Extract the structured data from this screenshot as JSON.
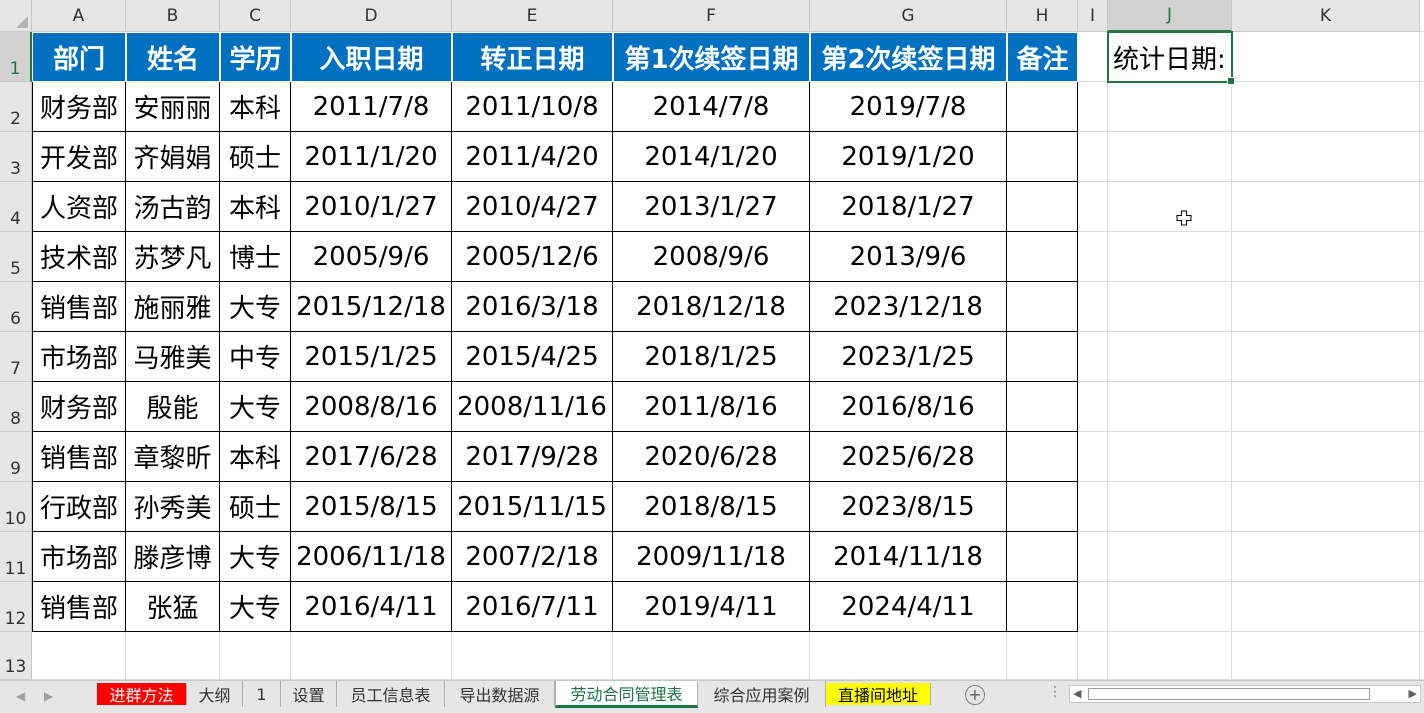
{
  "columns": [
    "A",
    "B",
    "C",
    "D",
    "E",
    "F",
    "G",
    "H",
    "I",
    "J",
    "K"
  ],
  "rows": [
    "1",
    "2",
    "3",
    "4",
    "5",
    "6",
    "7",
    "8",
    "9",
    "10",
    "11",
    "12",
    "13"
  ],
  "selected_column": "J",
  "selected_row": "1",
  "header_row": [
    "部门",
    "姓名",
    "学历",
    "入职日期",
    "转正日期",
    "第1次续签日期",
    "第2次续签日期",
    "备注"
  ],
  "data_rows": [
    [
      "财务部",
      "安丽丽",
      "本科",
      "2011/7/8",
      "2011/10/8",
      "2014/7/8",
      "2019/7/8",
      ""
    ],
    [
      "开发部",
      "齐娟娟",
      "硕士",
      "2011/1/20",
      "2011/4/20",
      "2014/1/20",
      "2019/1/20",
      ""
    ],
    [
      "人资部",
      "汤古韵",
      "本科",
      "2010/1/27",
      "2010/4/27",
      "2013/1/27",
      "2018/1/27",
      ""
    ],
    [
      "技术部",
      "苏梦凡",
      "博士",
      "2005/9/6",
      "2005/12/6",
      "2008/9/6",
      "2013/9/6",
      ""
    ],
    [
      "销售部",
      "施丽雅",
      "大专",
      "2015/12/18",
      "2016/3/18",
      "2018/12/18",
      "2023/12/18",
      ""
    ],
    [
      "市场部",
      "马雅美",
      "中专",
      "2015/1/25",
      "2015/4/25",
      "2018/1/25",
      "2023/1/25",
      ""
    ],
    [
      "财务部",
      "殷能",
      "大专",
      "2008/8/16",
      "2008/11/16",
      "2011/8/16",
      "2016/8/16",
      ""
    ],
    [
      "销售部",
      "章黎昕",
      "本科",
      "2017/6/28",
      "2017/9/28",
      "2020/6/28",
      "2025/6/28",
      ""
    ],
    [
      "行政部",
      "孙秀美",
      "硕士",
      "2015/8/15",
      "2015/11/15",
      "2018/8/15",
      "2023/8/15",
      ""
    ],
    [
      "市场部",
      "滕彦博",
      "大专",
      "2006/11/18",
      "2007/2/18",
      "2009/11/18",
      "2014/11/18",
      ""
    ],
    [
      "销售部",
      "张猛",
      "大专",
      "2016/4/11",
      "2016/7/11",
      "2019/4/11",
      "2024/4/11",
      ""
    ]
  ],
  "stat_cell": "统计日期:",
  "sheet_tabs": [
    {
      "label": "进群方法",
      "bg": "#ff0000",
      "color": "#ffffff"
    },
    {
      "label": "大纲",
      "bg": "",
      "color": ""
    },
    {
      "label": "1",
      "bg": "",
      "color": ""
    },
    {
      "label": "设置",
      "bg": "",
      "color": ""
    },
    {
      "label": "员工信息表",
      "bg": "",
      "color": ""
    },
    {
      "label": "导出数据源",
      "bg": "",
      "color": ""
    },
    {
      "label": "劳动合同管理表",
      "bg": "",
      "color": "",
      "active": true
    },
    {
      "label": "综合应用案例",
      "bg": "",
      "color": ""
    },
    {
      "label": "直播间地址",
      "bg": "#ffff00",
      "color": "#000000"
    }
  ],
  "colors": {
    "header_fill": "#0070c0",
    "selection": "#217346"
  },
  "icons": {
    "add_sheet": "plus-circle-icon",
    "cursor": "cell-select-cross-icon"
  }
}
